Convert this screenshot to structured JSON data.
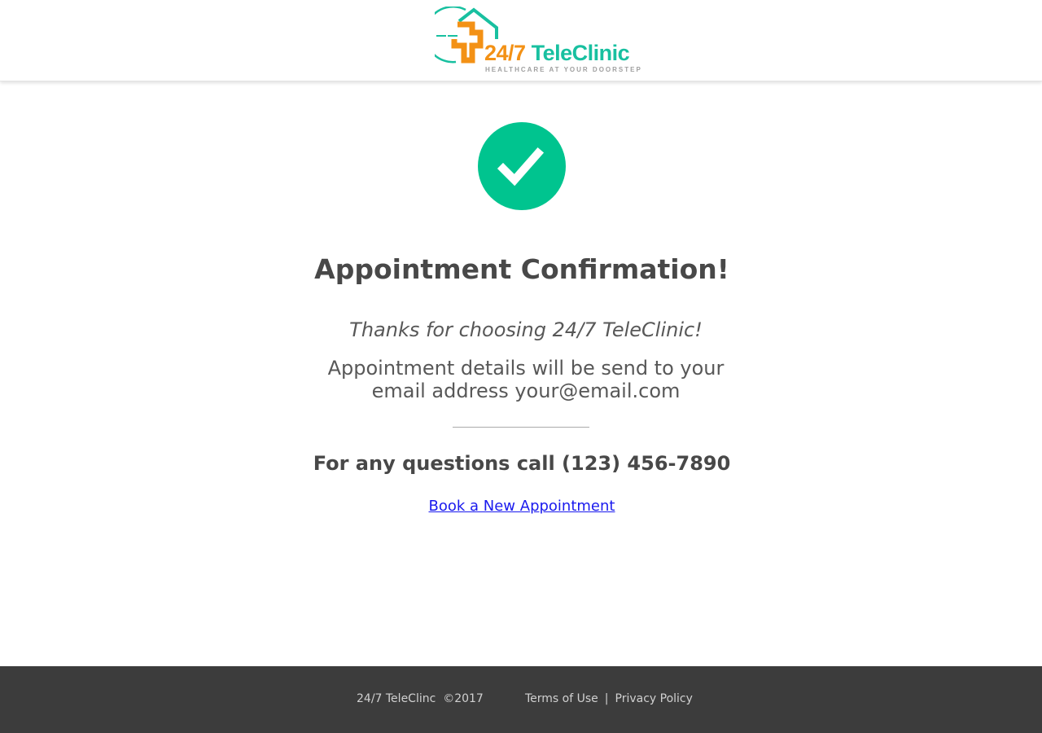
{
  "header": {
    "logo": {
      "brand_number": "24/7",
      "brand_name": "TeleClinic",
      "tagline": "HEALTHCARE AT YOUR DOORSTEP"
    }
  },
  "main": {
    "status_icon": "check-circle-icon",
    "title": "Appointment Confirmation!",
    "thanks": "Thanks for choosing 24/7 TeleClinic!",
    "details": "Appointment details will be send to your email address your@email.com",
    "questions": "For any questions call (123) 456-7890",
    "book_link": "Book a New Appointment"
  },
  "footer": {
    "copyright": "24/7 TeleClinc  ©2017",
    "terms": "Terms of Use",
    "separator": "|",
    "privacy": "Privacy Policy"
  },
  "colors": {
    "brand_orange": "#f39115",
    "brand_teal": "#18c0a0",
    "success_green": "#00c48f",
    "heading_text": "#484848",
    "body_text": "#585858",
    "link_blue": "#1a1aee",
    "footer_bg": "#3c3c3c",
    "footer_text": "#d0d0d0"
  }
}
